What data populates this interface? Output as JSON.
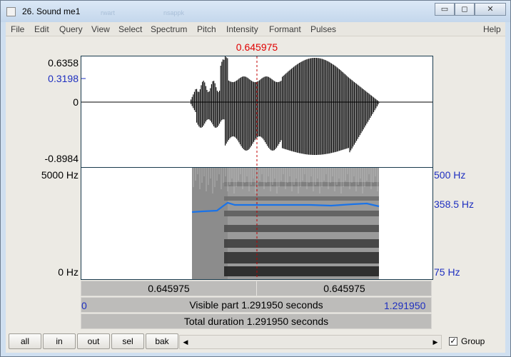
{
  "window": {
    "title": "26. Sound me1",
    "ghost_texts": [
      "rwart",
      "nsappk"
    ],
    "minimize_glyph": "▭",
    "maximize_glyph": "◻",
    "close_glyph": "✕"
  },
  "menu": [
    "File",
    "Edit",
    "Query",
    "View",
    "Select",
    "Spectrum",
    "Pitch",
    "Intensity",
    "Formant",
    "Pulses",
    "Help"
  ],
  "cursor": {
    "time_label": "0.645975",
    "color": "#e00000"
  },
  "waveform": {
    "y_max": "0.6358",
    "y_cursor_value": "0.3198",
    "y_zero": "0",
    "y_min": "-0.8984"
  },
  "spectrogram": {
    "freq_max": "5000 Hz",
    "freq_min": "0 Hz",
    "pitch_max": "500 Hz",
    "pitch_current": "358.5 Hz",
    "pitch_min": "75 Hz",
    "pitch_color": "#1a73e8"
  },
  "time_bar": {
    "left_value": "0.645975",
    "right_value": "0.645975",
    "visible_start": "0",
    "visible_end": "1.291950",
    "visible_label": "Visible part 1.291950 seconds",
    "total_label": "Total duration 1.291950 seconds"
  },
  "buttons": {
    "all": "all",
    "in": "in",
    "out": "out",
    "sel": "sel",
    "bak": "bak"
  },
  "scroll": {
    "left_arrow": "◀",
    "right_arrow": "▶"
  },
  "group": {
    "label": "Group",
    "checked": true,
    "check_glyph": "✓"
  }
}
